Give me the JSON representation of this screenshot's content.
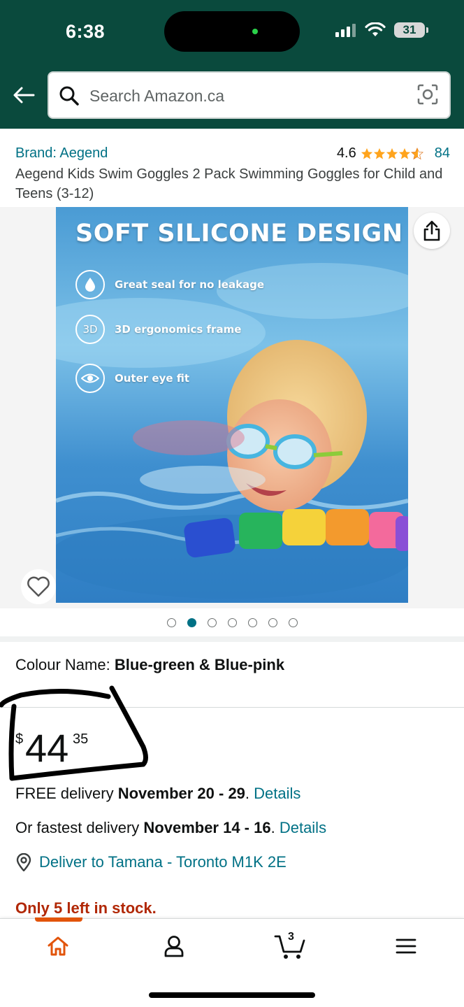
{
  "status_bar": {
    "time": "6:38",
    "battery": "31"
  },
  "search": {
    "placeholder": "Search Amazon.ca"
  },
  "product": {
    "brand": "Brand: Aegend",
    "rating": "4.6",
    "rating_value": 4.6,
    "review_count": "84",
    "title": "Aegend Kids Swim Goggles 2 Pack Swimming Goggles for Child and Teens (3-12)"
  },
  "gallery": {
    "headline": "SOFT SILICONE DESIGN",
    "features": [
      {
        "icon": "droplet-icon",
        "badge": "",
        "label": "Great seal for no leakage"
      },
      {
        "icon": "3d-icon",
        "badge": "3D",
        "label": "3D ergonomics frame"
      },
      {
        "icon": "eye-icon",
        "badge": "",
        "label": "Outer eye fit"
      }
    ],
    "image_count": 7,
    "active_index": 1
  },
  "colour": {
    "label": "Colour Name: ",
    "value": "Blue-green & Blue-pink"
  },
  "price": {
    "currency": "$",
    "whole": "44",
    "fraction": "35"
  },
  "delivery": {
    "free_prefix": "FREE delivery ",
    "free_dates": "November 20 - 29",
    "free_suffix": ". ",
    "free_link": "Details",
    "fast_prefix": "Or fastest delivery ",
    "fast_dates": "November 14 - 16",
    "fast_suffix": ". ",
    "fast_link": "Details"
  },
  "deliver_to": "Deliver to Tamana - Toronto M1K 2E",
  "stock": "Only 5 left in stock.",
  "bottom_nav": {
    "items": [
      {
        "icon": "home-icon"
      },
      {
        "icon": "account-icon"
      },
      {
        "icon": "cart-icon",
        "badge": "3"
      },
      {
        "icon": "menu-icon"
      }
    ],
    "active": "home"
  },
  "colors": {
    "header": "#0a4a3d",
    "link": "#007185",
    "star": "#ffa41c",
    "stock": "#b12704",
    "nav_active": "#e2540b"
  }
}
